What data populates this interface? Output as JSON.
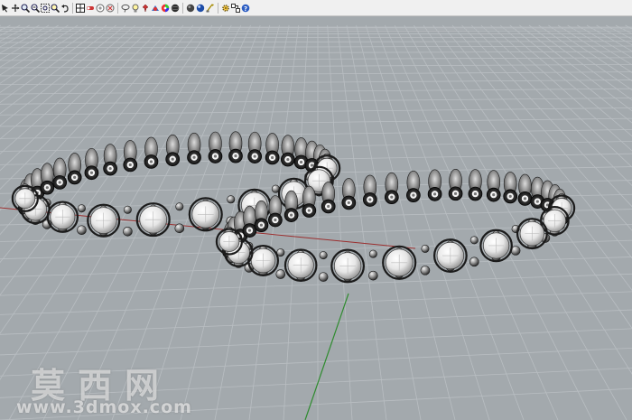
{
  "toolbar": {
    "icons": [
      "pan-arrow-icon",
      "rotate-view-icon",
      "zoom-window-icon",
      "zoom-dynamic-icon",
      "zoom-extents-icon",
      "zoom-selected-icon",
      "undo-view-icon",
      "four-viewports-icon",
      "toggle-osnap-icon",
      "circle-object-icon",
      "cancel-view-icon",
      "lasso-icon",
      "lightbulb-icon",
      "pin-icon",
      "material-palette-icon",
      "color-wheel-icon",
      "wireframe-sphere-icon",
      "shaded-sphere-icon",
      "render-sphere-icon",
      "dimension-icon",
      "options-gear-icon",
      "toolbar-layout-icon",
      "help-icon"
    ]
  },
  "viewport": {
    "mode": "Perspective",
    "background_color": "#a3a9ad",
    "grid_color": "#b9bec2",
    "x_axis_color": "#9b2f2f",
    "y_axis_color": "#2e8b2e"
  },
  "watermark": {
    "chinese": "莫西网",
    "url": "www.3dmox.com"
  }
}
